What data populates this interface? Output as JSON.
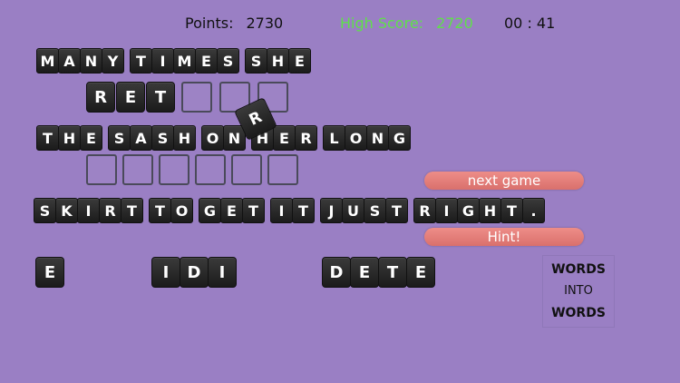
{
  "hud": {
    "points_label": "Points:",
    "points_value": "2730",
    "high_label": "High Score:",
    "high_value": "2720",
    "timer": "00 : 41",
    "high_color": "#5fe04a"
  },
  "line1": [
    "MANY",
    "TIMES",
    "SHE"
  ],
  "line2": {
    "letters": [
      "R",
      "E",
      "T"
    ],
    "empty_slots": 3
  },
  "line3": [
    "THE",
    "SASH",
    "ON",
    "HER",
    "LONG"
  ],
  "line4": {
    "empty_slots": 6
  },
  "line5": [
    "SKIRT",
    "TO",
    "GET",
    "IT",
    "JUST",
    "RIGHT."
  ],
  "pool": [
    "E",
    "IDI",
    "DETE"
  ],
  "dragged_tile": "R",
  "buttons": {
    "next_game": "next game",
    "hint": "Hint!"
  },
  "logo": {
    "line1": "WORDS",
    "line2": "INTO",
    "line3": "WORDS"
  },
  "colors": {
    "background": "#9a7fc4",
    "button": "#e07c77",
    "tile": "#262626"
  }
}
